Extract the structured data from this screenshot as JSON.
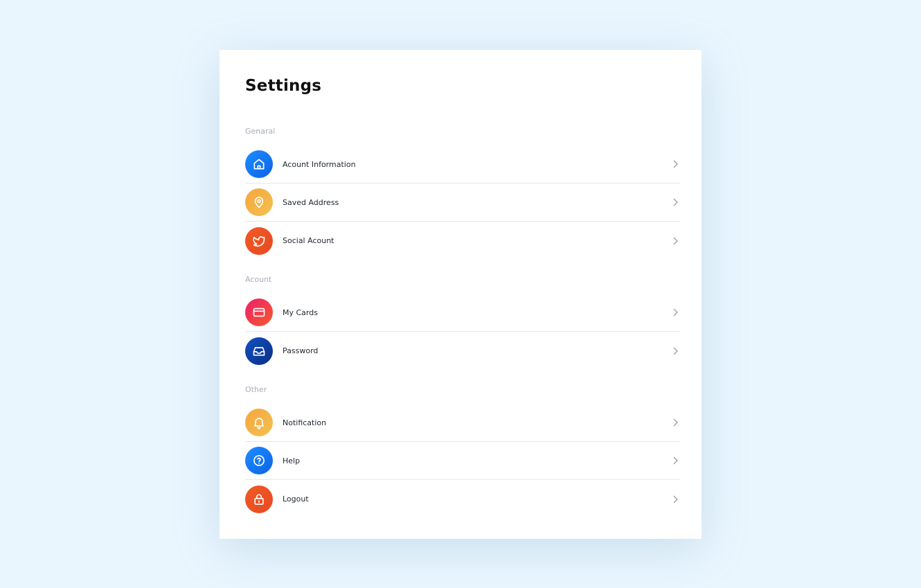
{
  "settings": {
    "title": "Settings",
    "sections": [
      {
        "label": "Genaral",
        "items": [
          {
            "label": "Acount Information",
            "icon": "home-icon",
            "color": "#1f8cff"
          },
          {
            "label": "Saved Address",
            "icon": "location-pin-icon",
            "color": "#f4a53f"
          },
          {
            "label": "Social Acount",
            "icon": "twitter-bird-icon",
            "color": "#f05a28"
          }
        ]
      },
      {
        "label": "Acount",
        "items": [
          {
            "label": "My Cards",
            "icon": "credit-card-icon",
            "color": "#ee1e6c"
          },
          {
            "label": "Password",
            "icon": "inbox-icon",
            "color": "#1251c0"
          }
        ]
      },
      {
        "label": "Other",
        "items": [
          {
            "label": "Notification",
            "icon": "bell-icon",
            "color": "#f4a53f"
          },
          {
            "label": "Help",
            "icon": "help-circle-icon",
            "color": "#1f8cff"
          },
          {
            "label": "Logout",
            "icon": "lock-icon",
            "color": "#f05a28"
          }
        ]
      }
    ]
  }
}
